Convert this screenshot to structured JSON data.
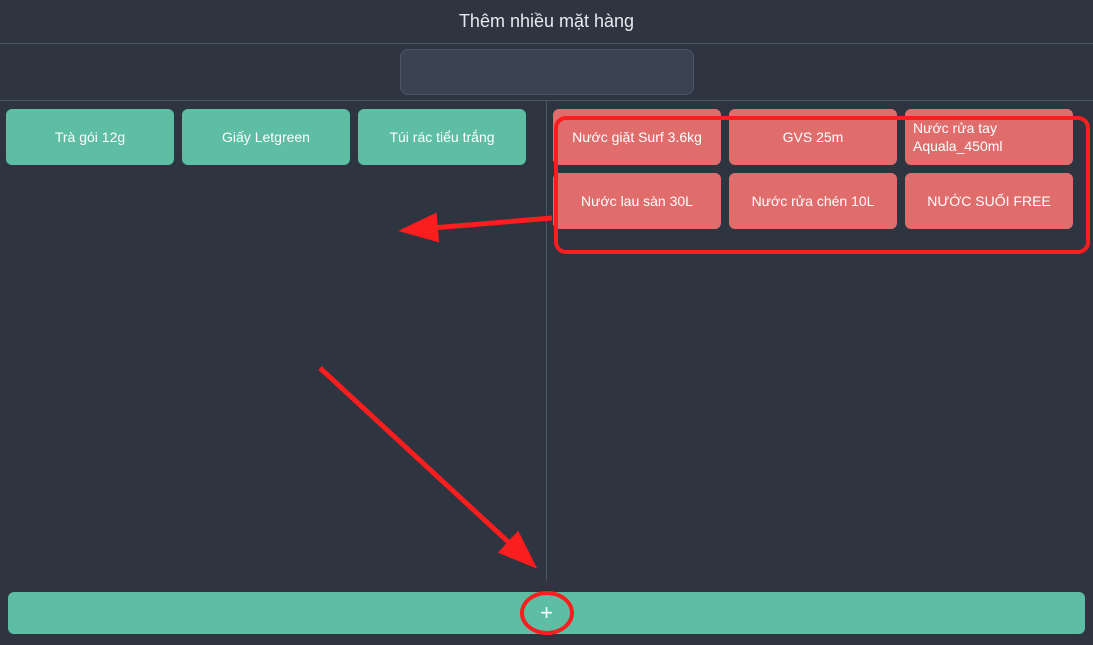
{
  "header": {
    "title": "Thêm nhiều mặt hàng"
  },
  "search": {
    "value": "",
    "placeholder": ""
  },
  "left_panel": {
    "items": [
      {
        "label": "Trà gói 12g"
      },
      {
        "label": "Giấy Letgreen"
      },
      {
        "label": "Túi rác tiểu trắng"
      }
    ]
  },
  "right_panel": {
    "items": [
      {
        "label": "Nước giặt Surf 3.6kg"
      },
      {
        "label": "GVS 25m"
      },
      {
        "label": "Nước rửa tay Aquala_450ml"
      },
      {
        "label": "Nước lau sàn 30L"
      },
      {
        "label": "Nước rửa chén 10L"
      },
      {
        "label": "NƯỚC SUỐI FREE"
      }
    ]
  },
  "footer": {
    "add_label": "+"
  },
  "colors": {
    "bg": "#2e3440",
    "panel_border": "#4c566a",
    "card_green": "#5dbea3",
    "card_red": "#e06c6c",
    "annotation_red": "#fa1e1e"
  }
}
